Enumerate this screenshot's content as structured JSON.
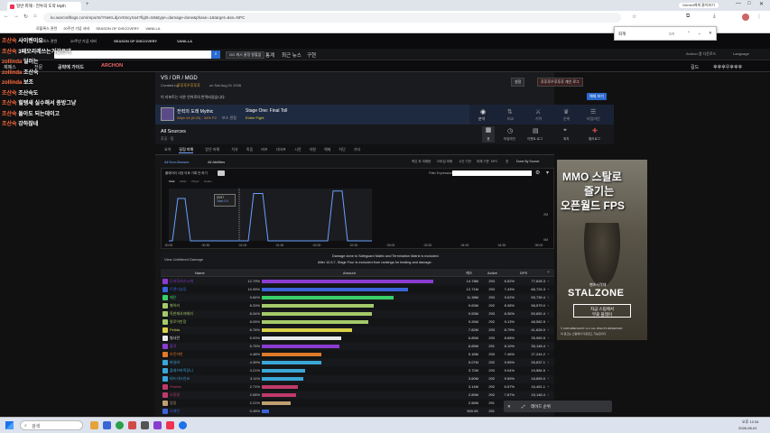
{
  "browser": {
    "tab_title": "일반 피해 - 전투의 도약 Myth",
    "url": "ko.warcraftlogs.com/reports/YNeKLdjxVK5cyXa4?fight=50&type=damage-done&phase=1&target=&ss=NPC",
    "bookmarks": [
      "로블록스 관련",
      "20주년 기념 서버",
      "SEASON OF DISCOVERY",
      "VANILLA",
      "게임",
      "기타",
      "YouTube",
      "유튜브",
      "와우의 위키와",
      "인벤",
      "오토",
      "개인 소통 회원"
    ],
    "profile_label": "Gemini에게 물어보기"
  },
  "popup": {
    "field_label": "회계",
    "value": "0/0"
  },
  "chat": [
    {
      "user": "조산숙",
      "msg": "사이렌이요"
    },
    {
      "user": "조산숙",
      "msg": "3페모리레쓰는거같은데"
    },
    {
      "user": "zollinda",
      "msg": "딜러는"
    },
    {
      "user": "zollinda",
      "msg": "조산숙"
    },
    {
      "user": "zollinda",
      "msg": "보조"
    },
    {
      "user": "조산숙",
      "msg": "조산숙도"
    },
    {
      "user": "조산숙",
      "msg": "힐탱새 실수해서 종방그냥"
    },
    {
      "user": "조산숙",
      "msg": "돌아도 되는데이고"
    },
    {
      "user": "조산숙",
      "msg": "강하잖네"
    }
  ],
  "site": {
    "search_placeholder": "캐릭터, 길드, 보고서 검색",
    "nav_items": [
      "통계",
      "최근 뉴스",
      "구현"
    ],
    "alt_btn": "GG 캐시 꿀정 왕할없",
    "menu_items": [
      "제폐스",
      "전문",
      "공략에 가이드",
      "ARCHON"
    ],
    "account_label": "Archon 앱 다운로드",
    "language": "Language",
    "guild": "길드",
    "user": "후후후우후후후"
  },
  "report": {
    "title": "VS / DR / MGD",
    "created_prefix": "Created by",
    "created_by": "후후후우후후후",
    "created_suffix": "on Sat Aug 01 2026",
    "notice": "이 리포트는 다른 언어로의 번역되었습니다:",
    "settings_btn": "설정",
    "owner_btn": "후후후우후후후 개인 로그",
    "notice_btn": "해제 보기"
  },
  "fight": {
    "name": "전력의 도래 Mythic",
    "stats": "Wipe #4 (5:29) - 44% P2",
    "phase_label": "보스 관점",
    "phase_name": "Stage One: Final Toll",
    "fight_mode": "Entire Fight",
    "right_tabs": [
      "분석",
      "비교",
      "기어",
      "순위",
      "타임라인"
    ]
  },
  "sources": {
    "title": "All Sources",
    "sub": "후공 · 팀",
    "icons": [
      "표",
      "타임라인",
      "이벤트 로그",
      "위치",
      "힐러로그"
    ]
  },
  "subtabs": [
    "요약",
    "딜링 피해",
    "받은 피해",
    "치유",
    "죽음",
    "버프",
    "디버프",
    "시전",
    "자원",
    "해제",
    "차단",
    "기타"
  ],
  "filters": {
    "left": [
      "All Non-Bosses",
      "All Abilities"
    ],
    "right": [
      "죽은 후 피해량",
      "오버킬 피해",
      "시간 기반",
      "피해 기준",
      "NPC",
      "표",
      "Done By Source"
    ],
    "graph_label": "플레이어 사망 이후 기록 안 하기",
    "expr_label": "Filter Expression:"
  },
  "graph": {
    "tooltip_time": "00:57",
    "tooltip_value": "Total: 0.0",
    "legend": [
      "Total",
      "Ability",
      "Player",
      "Healer"
    ],
    "y_labels": [
      "2M",
      "0M"
    ],
    "x_labels": [
      "00:00",
      "00:30",
      "01:00",
      "01:30",
      "02:00",
      "02:30",
      "03:00",
      "03:30",
      "04:00",
      "04:30",
      "05:00"
    ]
  },
  "chart_data": {
    "type": "area",
    "x": [
      "00:00",
      "00:30",
      "01:00",
      "01:30",
      "02:00",
      "02:30",
      "03:00",
      "03:30",
      "04:00",
      "04:30",
      "05:00"
    ],
    "series": [
      {
        "name": "Total",
        "values": [
          0.3,
          0.0,
          2.0,
          0.0,
          2.0,
          0.0,
          0.0,
          0.0,
          0.0,
          0.0,
          0.0
        ]
      }
    ],
    "ylim": [
      0,
      2.1
    ]
  },
  "damage_note": {
    "view_link": "View Unfiltered Damage",
    "line1": "Damage done to Safeguard Matrix and Termination Matrix is excluded.",
    "line2": "After 12.6.7, Stage Four is excluded from rankings for healing and damage."
  },
  "table": {
    "headers": [
      "Name",
      "Amount",
      "캐스",
      "Active",
      "DPS"
    ],
    "rows": [
      {
        "name": "도라무리스시개",
        "pct": "12.79%",
        "amount": "14.78M",
        "cnt": "293",
        "active": "6.52%",
        "dps": "77,628.3",
        "color": "#8a3cd0",
        "bar": 0.95
      },
      {
        "name": "트렌디슬링",
        "pct": "10.95%",
        "amount": "12.71M",
        "cnt": "293",
        "active": "7.43%",
        "dps": "66,724.3",
        "color": "#3a64d8",
        "bar": 0.81
      },
      {
        "name": "매은",
        "pct": "9.84%",
        "amount": "11.38M",
        "cnt": "293",
        "active": "9.02%",
        "dps": "59,739.4",
        "color": "#3ad068",
        "bar": 0.73
      },
      {
        "name": "별하리",
        "pct": "8.33%",
        "amount": "9.63M",
        "cnt": "292",
        "active": "8.38%",
        "dps": "58,579.0",
        "color": "#a5c96a",
        "bar": 0.62
      },
      {
        "name": "독한재사자메리",
        "pct": "8.34%",
        "amount": "9.53M",
        "cnt": "293",
        "active": "8.36%",
        "dps": "50,652.4",
        "color": "#a5c96a",
        "bar": 0.61
      },
      {
        "name": "말로이만장",
        "pct": "8.05%",
        "amount": "9.26M",
        "cnt": "292",
        "active": "9.13%",
        "dps": "48,582.5",
        "color": "#a5c96a",
        "bar": 0.59
      },
      {
        "name": "Pelida",
        "pct": "6.76%",
        "amount": "7.82M",
        "cnt": "293",
        "active": "8.79%",
        "dps": "41,626.0",
        "color": "#d8d048",
        "bar": 0.5
      },
      {
        "name": "빌사란",
        "pct": "5.93%",
        "amount": "6.85M",
        "cnt": "293",
        "active": "8.68%",
        "dps": "35,969.5",
        "color": "#e8e8e8",
        "bar": 0.44
      },
      {
        "name": "힐귀",
        "pct": "5.75%",
        "amount": "6.65M",
        "cnt": "291",
        "active": "8.10%",
        "dps": "35,148.4",
        "color": "#8a3cd0",
        "bar": 0.43
      },
      {
        "name": "아웃하반",
        "pct": "4.48%",
        "amount": "5.18M",
        "cnt": "293",
        "active": "7.46%",
        "dps": "27,244.2",
        "color": "#e07a2a",
        "bar": 0.33
      },
      {
        "name": "바실비",
        "pct": "4.39%",
        "amount": "5.07M",
        "cnt": "292",
        "active": "9.55%",
        "dps": "26,637.1",
        "color": "#3aa6d8",
        "bar": 0.33
      },
      {
        "name": "플레브마직링니",
        "pct": "3.21%",
        "amount": "3.72M",
        "cnt": "293",
        "active": "9.04%",
        "dps": "19,584.5",
        "color": "#3aa6d8",
        "bar": 0.24
      },
      {
        "name": "비드가스인코",
        "pct": "3.11%",
        "amount": "3.60M",
        "cnt": "292",
        "active": "9.59%",
        "dps": "18,859.0",
        "color": "#3aa6d8",
        "bar": 0.23
      },
      {
        "name": "Rinellis",
        "pct": "2.71%",
        "amount": "3.14M",
        "cnt": "292",
        "active": "6.57%",
        "dps": "16,461.1",
        "color": "#c03a6a",
        "bar": 0.2
      },
      {
        "name": "오징칼",
        "pct": "2.08%",
        "amount": "2.89M",
        "cnt": "292",
        "active": "7.87%",
        "dps": "15,148.4",
        "color": "#c03a6a",
        "bar": 0.19
      },
      {
        "name": "잉잉",
        "pct": "2.21%",
        "amount": "2.56M",
        "cnt": "291",
        "active": "0.01%",
        "dps": "",
        "color": "#c0a070",
        "bar": 0.16
      },
      {
        "name": "오메린",
        "pct": "0.45%",
        "amount": "500.0K",
        "cnt": "291",
        "active": "",
        "dps": "",
        "color": "#3a64d8",
        "bar": 0.04
      }
    ]
  },
  "ad": {
    "line1": "MMO 스탈로",
    "line2": "즐기는",
    "line3": "오픈월드 FPS",
    "cta": "지금 스팀에서",
    "cta2": "무료 플레이",
    "brand_sub": "팬츠사격대",
    "brand": "STALZONE",
    "copyright": "© 2026 EBENGAST LLC ALL RIGHTS RESERVED",
    "copyright2": "이 광고는 스팀에서 다운로드 가능합니다"
  },
  "toast": {
    "label": "레이드 순위"
  },
  "taskbar": {
    "search": "검색",
    "time": "오후 12:34",
    "date": "2026-08-02"
  }
}
